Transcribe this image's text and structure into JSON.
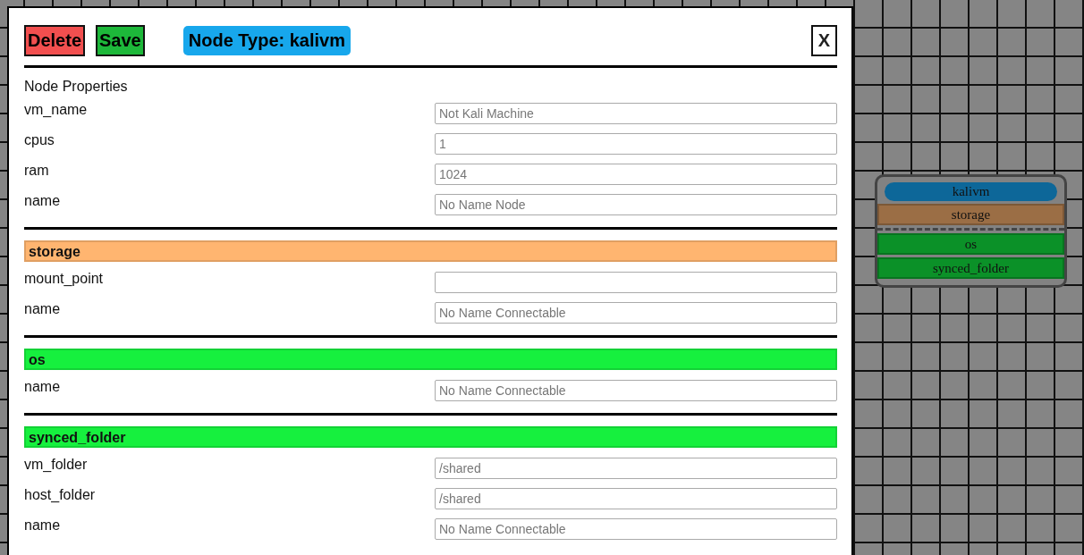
{
  "toolbar": {
    "delete": "Delete",
    "save": "Save",
    "node_type": "Node Type: kalivm",
    "close": "X"
  },
  "properties_heading": "Node Properties",
  "properties": [
    {
      "label": "vm_name",
      "placeholder": "Not Kali Machine"
    },
    {
      "label": "cpus",
      "placeholder": "1"
    },
    {
      "label": "ram",
      "placeholder": "1024"
    },
    {
      "label": "name",
      "placeholder": "No Name Node"
    }
  ],
  "sections": [
    {
      "title": "storage",
      "color": "#ffb570",
      "fields": [
        {
          "label": "mount_point"
        },
        {
          "label": "name",
          "placeholder": "No Name Connectable"
        }
      ]
    },
    {
      "title": "os",
      "color": "#16f03e",
      "fields": [
        {
          "label": "name",
          "placeholder": "No Name Connectable"
        }
      ]
    },
    {
      "title": "synced_folder",
      "color": "#16f03e",
      "fields": [
        {
          "label": "vm_folder",
          "placeholder": "/shared"
        },
        {
          "label": "host_folder",
          "placeholder": "/shared"
        },
        {
          "label": "name",
          "placeholder": "No Name Connectable"
        }
      ]
    }
  ],
  "node": {
    "title": "kalivm",
    "color": "#0d6799",
    "groups": [
      [
        {
          "label": "storage",
          "color": "#9b6e45"
        }
      ],
      [
        {
          "label": "os",
          "color": "#0b9128"
        },
        {
          "label": "synced_folder",
          "color": "#0b9128"
        }
      ]
    ]
  }
}
